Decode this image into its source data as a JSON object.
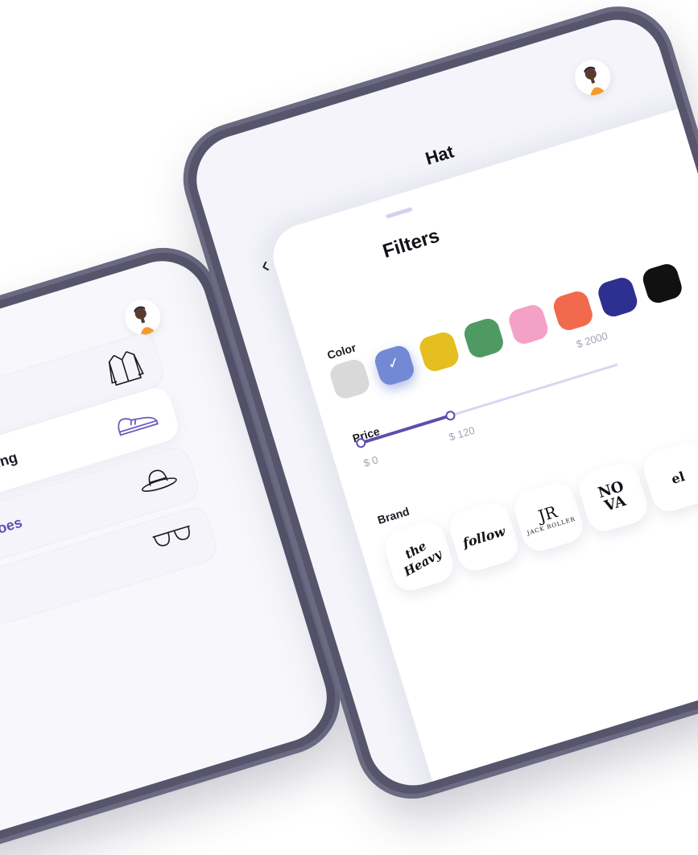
{
  "left_phone": {
    "categories": [
      {
        "label": "",
        "icon": "shirt-icon"
      },
      {
        "label": "Clothing",
        "icon": ""
      },
      {
        "label": "",
        "icon": "shoe-icon"
      },
      {
        "label": "Shoes",
        "icon": ""
      },
      {
        "label": "",
        "icon": "hat-icon"
      },
      {
        "label": "",
        "icon": "sunglasses-icon"
      }
    ],
    "items": [
      {
        "label": "Clothing",
        "icon": "shirt-icon",
        "active": false
      },
      {
        "label": "Shoes",
        "icon": "shoe-icon",
        "active": true
      },
      {
        "label": "",
        "icon": "hat-icon",
        "active": false
      },
      {
        "label": "",
        "icon": "sunglasses-icon",
        "active": false
      }
    ]
  },
  "right_phone": {
    "title": "Hat",
    "filters": {
      "title": "Filters",
      "color_label": "Color",
      "colors": [
        "#d9d9d9",
        "#7289d6",
        "#e5be1f",
        "#4f9a63",
        "#f4a1c7",
        "#f26a4d",
        "#2d2f91",
        "#111111"
      ],
      "selected_color_index": 1,
      "price_label": "Price",
      "price_min": "$ 0",
      "price_selected": "$ 120",
      "price_max": "$ 2000",
      "price_fraction": 0.35,
      "brand_label": "Brand",
      "brands": [
        {
          "name": "the heavy",
          "text": "the Heavy"
        },
        {
          "name": "follow",
          "text": "follow"
        },
        {
          "name": "jack roller",
          "text": "JR",
          "sub": "JACK ROLLER"
        },
        {
          "name": "nova",
          "text": "NO VA"
        },
        {
          "name": "el",
          "text": "el"
        }
      ]
    }
  },
  "colors": {
    "accent": "#5b4fb0",
    "slider_track": "#d9d6f2"
  }
}
